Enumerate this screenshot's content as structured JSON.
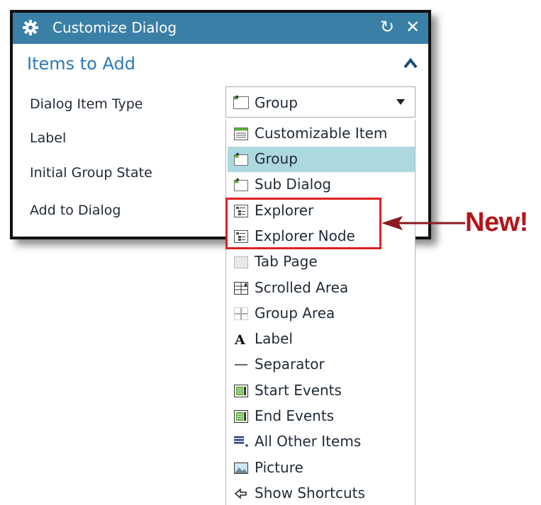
{
  "dialog": {
    "title": "Customize Dialog",
    "title_icon": "gear-icon",
    "reset_icon": "reset-icon",
    "close_icon": "close-icon",
    "titlebar_color": "#3a7fa6"
  },
  "section": {
    "title": "Items to Add",
    "collapse_icon": "chevron-up-icon",
    "title_color": "#2c7ab8"
  },
  "form": {
    "rows": [
      {
        "label": "Dialog Item Type"
      },
      {
        "label": "Label"
      },
      {
        "label": "Initial Group State"
      },
      {
        "label": "Add to Dialog"
      }
    ],
    "item_type_select": {
      "value": "Group",
      "icon": "group-icon"
    }
  },
  "dropdown": {
    "selected_color": "#aed8e0",
    "options": [
      {
        "label": "Customizable Item",
        "icon": "customizable-item-icon",
        "selected": false
      },
      {
        "label": "Group",
        "icon": "group-icon",
        "selected": true
      },
      {
        "label": "Sub Dialog",
        "icon": "sub-dialog-icon",
        "selected": false
      },
      {
        "label": "Explorer",
        "icon": "explorer-icon",
        "selected": false
      },
      {
        "label": "Explorer Node",
        "icon": "explorer-node-icon",
        "selected": false
      },
      {
        "label": "Tab Page",
        "icon": "tab-page-icon",
        "selected": false
      },
      {
        "label": "Scrolled Area",
        "icon": "scrolled-area-icon",
        "selected": false
      },
      {
        "label": "Group Area",
        "icon": "group-area-icon",
        "selected": false
      },
      {
        "label": "Label",
        "icon": "label-icon",
        "selected": false
      },
      {
        "label": "Separator",
        "icon": "separator-icon",
        "selected": false
      },
      {
        "label": "Start Events",
        "icon": "start-events-icon",
        "selected": false
      },
      {
        "label": "End Events",
        "icon": "end-events-icon",
        "selected": false
      },
      {
        "label": "All Other Items",
        "icon": "all-other-items-icon",
        "selected": false
      },
      {
        "label": "Picture",
        "icon": "picture-icon",
        "selected": false
      },
      {
        "label": "Show Shortcuts",
        "icon": "show-shortcuts-icon",
        "selected": false
      }
    ]
  },
  "annotation": {
    "text": "New!",
    "color": "#b3141b",
    "highlight_color": "#e02020"
  }
}
